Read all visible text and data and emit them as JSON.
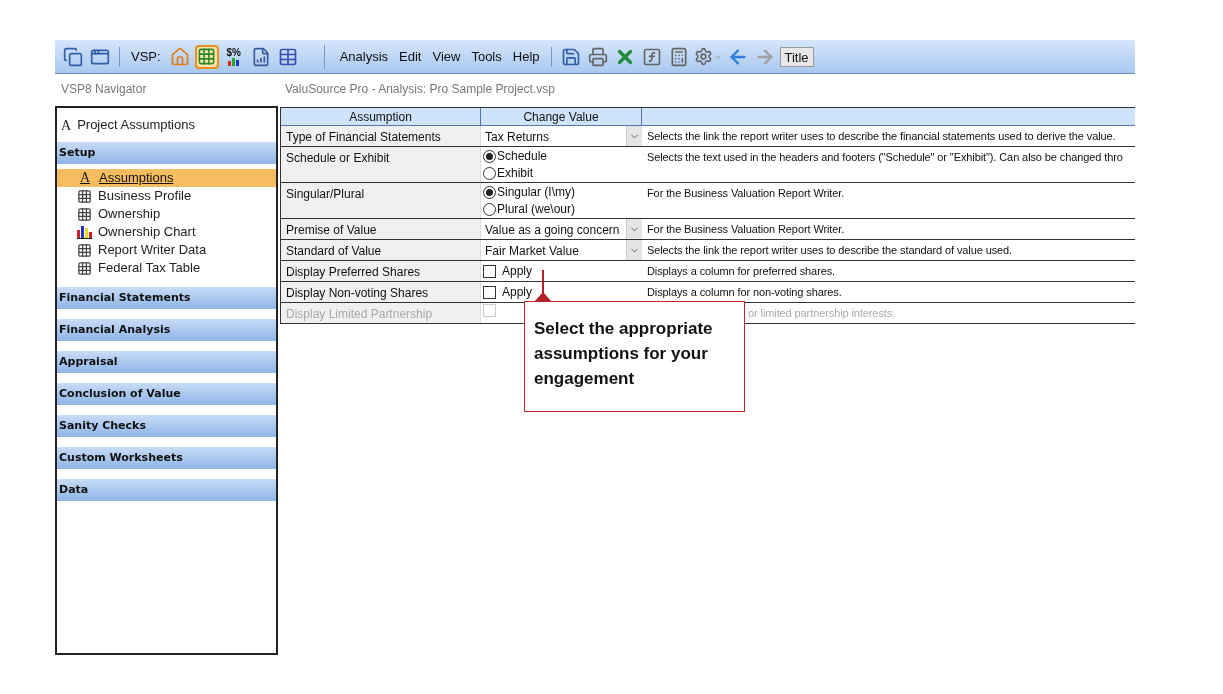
{
  "toolbar": {
    "items": [
      {
        "kind": "cascade"
      },
      {
        "kind": "window"
      },
      {
        "kind": "separator"
      },
      {
        "kind": "label",
        "text": "VSP:"
      },
      {
        "kind": "home",
        "selected": false
      },
      {
        "kind": "grid",
        "selected": true
      },
      {
        "kind": "chart",
        "text": "$%",
        "selected": false
      },
      {
        "kind": "report",
        "selected": false
      },
      {
        "kind": "table",
        "selected": false
      }
    ],
    "menu": [
      "Analysis",
      "Edit",
      "View",
      "Tools",
      "Help"
    ],
    "tools": [
      {
        "kind": "save"
      },
      {
        "kind": "print"
      },
      {
        "kind": "excel"
      },
      {
        "kind": "formula"
      },
      {
        "kind": "calculator"
      },
      {
        "kind": "settings-dropdown"
      },
      {
        "kind": "back"
      },
      {
        "kind": "forward"
      },
      {
        "kind": "button",
        "text": "Title"
      }
    ]
  },
  "navigator": {
    "title": "VSP8 Navigator",
    "header": {
      "icon_char": "A",
      "label": "Project Assumptions"
    },
    "sections": [
      {
        "title": "Setup",
        "items": [
          {
            "kind": "letter",
            "icon_char": "A",
            "label": "Assumptions",
            "selected": true
          },
          {
            "kind": "grid",
            "label": "Business Profile",
            "selected": false
          },
          {
            "kind": "grid",
            "label": "Ownership",
            "selected": false
          },
          {
            "kind": "chart",
            "label": "Ownership Chart",
            "selected": false
          },
          {
            "kind": "grid",
            "label": "Report Writer Data",
            "selected": false
          },
          {
            "kind": "grid",
            "label": "Federal Tax Table",
            "selected": false
          }
        ]
      },
      {
        "title": "Financial Statements"
      },
      {
        "title": "Financial Analysis"
      },
      {
        "title": "Appraisal"
      },
      {
        "title": "Conclusion of Value"
      },
      {
        "title": "Sanity Checks"
      },
      {
        "title": "Custom Worksheets"
      },
      {
        "title": "Data"
      }
    ]
  },
  "document": {
    "title": "ValuSource Pro - Analysis: Pro Sample Project.vsp",
    "table": {
      "columns": [
        "Assumption",
        "Change Value"
      ],
      "rows": [
        {
          "kind": "dropdown",
          "assumption": "Type of Financial Statements",
          "value": "Tax Returns",
          "disabled": false,
          "description": "Selects the link the report writer uses to describe the financial statements used to derive the value."
        },
        {
          "kind": "radio",
          "assumption": "Schedule or Exhibit",
          "options": [
            {
              "label": "Schedule",
              "selected": true
            },
            {
              "label": "Exhibit",
              "selected": false
            }
          ],
          "disabled": false,
          "description": "Selects the text used in the headers and footers (\"Schedule\" or \"Exhibit\"). Can also be changed thro"
        },
        {
          "kind": "radio",
          "assumption": "Singular/Plural",
          "options": [
            {
              "label": "Singular (I\\my)",
              "selected": true
            },
            {
              "label": "Plural (we\\our)",
              "selected": false
            }
          ],
          "disabled": false,
          "description": "For the Business Valuation Report Writer."
        },
        {
          "kind": "dropdown",
          "assumption": "Premise of Value",
          "value": "Value as a going concern",
          "disabled": false,
          "description": "For the Business Valuation Report Writer."
        },
        {
          "kind": "dropdown",
          "assumption": "Standard of Value",
          "value": "Fair Market Value",
          "disabled": false,
          "description": "Selects the link the report writer uses to describe the standard of  value used."
        },
        {
          "kind": "checkbox",
          "assumption": "Display Preferred Shares",
          "label": "Apply",
          "checked": false,
          "disabled": false,
          "description": "Displays a column for preferred shares."
        },
        {
          "kind": "checkbox",
          "assumption": "Display Non-voting Shares",
          "label": "Apply",
          "checked": false,
          "disabled": false,
          "description": "Displays a column for non-voting shares."
        },
        {
          "kind": "checkbox",
          "assumption": "Display Limited Partnership",
          "checked": false,
          "disabled": true,
          "description": "or limited partnership interests."
        }
      ]
    }
  },
  "callout": {
    "text": "Select the appropriate assumptions for your engagement"
  }
}
